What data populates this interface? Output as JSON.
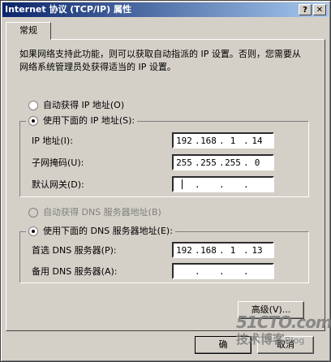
{
  "window": {
    "title": "Internet 协议 (TCP/IP) 属性",
    "help_glyph": "?",
    "close_glyph": "✕"
  },
  "tabs": [
    {
      "label": "常规"
    }
  ],
  "description": "如果网络支持此功能，则可以获取自动指派的 IP 设置。否则，您需要从网络系统管理员处获得适当的 IP 设置。",
  "ip_section": {
    "auto_label": "自动获得 IP 地址(O)",
    "manual_label": "使用下面的 IP 地址(S):",
    "selected": "manual",
    "fields": [
      {
        "label": "IP 地址(I):",
        "octets": [
          "192",
          "168",
          "1",
          "14"
        ]
      },
      {
        "label": "子网掩码(U):",
        "octets": [
          "255",
          "255",
          "255",
          "0"
        ]
      },
      {
        "label": "默认网关(D):",
        "octets": [
          "",
          "",
          "",
          ""
        ]
      }
    ]
  },
  "dns_section": {
    "auto_label": "自动获得 DNS 服务器地址(B)",
    "manual_label": "使用下面的 DNS 服务器地址(E):",
    "selected": "manual",
    "fields": [
      {
        "label": "首选 DNS 服务器(P):",
        "octets": [
          "192",
          "168",
          "1",
          "13"
        ]
      },
      {
        "label": "备用 DNS 服务器(A):",
        "octets": [
          "",
          "",
          "",
          ""
        ]
      }
    ]
  },
  "buttons": {
    "advanced": "高级(V)...",
    "ok": "确",
    "cancel": "取消"
  },
  "watermark": {
    "top": "51CTO.com",
    "bottom": "技术博客",
    "blog": "Blog"
  }
}
